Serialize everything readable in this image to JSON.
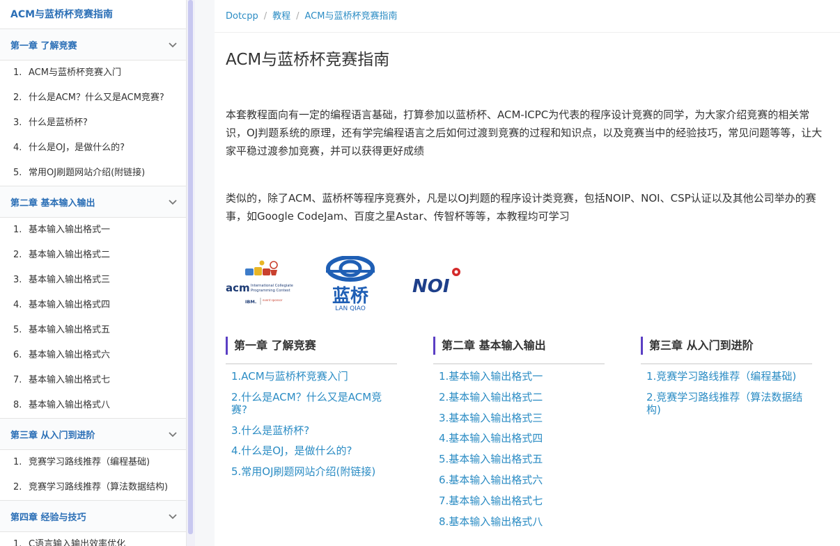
{
  "sidebar": {
    "title": "ACM与蓝桥杯竞赛指南",
    "chapters": [
      {
        "label": "第一章 了解竞赛",
        "items": [
          {
            "num": "1.",
            "label": "ACM与蓝桥杯竞赛入门"
          },
          {
            "num": "2.",
            "label": "什么是ACM？什么又是ACM竞赛?"
          },
          {
            "num": "3.",
            "label": "什么是蓝桥杯?"
          },
          {
            "num": "4.",
            "label": "什么是OJ，是做什么的?"
          },
          {
            "num": "5.",
            "label": "常用OJ刷题网站介绍(附链接)"
          }
        ]
      },
      {
        "label": "第二章 基本输入输出",
        "items": [
          {
            "num": "1.",
            "label": "基本输入输出格式一"
          },
          {
            "num": "2.",
            "label": "基本输入输出格式二"
          },
          {
            "num": "3.",
            "label": "基本输入输出格式三"
          },
          {
            "num": "4.",
            "label": "基本输入输出格式四"
          },
          {
            "num": "5.",
            "label": "基本输入输出格式五"
          },
          {
            "num": "6.",
            "label": "基本输入输出格式六"
          },
          {
            "num": "7.",
            "label": "基本输入输出格式七"
          },
          {
            "num": "8.",
            "label": "基本输入输出格式八"
          }
        ]
      },
      {
        "label": "第三章 从入门到进阶",
        "items": [
          {
            "num": "1.",
            "label": "竞赛学习路线推荐（编程基础)"
          },
          {
            "num": "2.",
            "label": "竞赛学习路线推荐（算法数据结构)"
          }
        ]
      },
      {
        "label": "第四章 经验与技巧",
        "items": [
          {
            "num": "1.",
            "label": "C语言输入输出效率优化"
          }
        ]
      }
    ]
  },
  "breadcrumb": [
    "Dotcpp",
    "教程",
    "ACM与蓝桥杯竞赛指南"
  ],
  "page_title": "ACM与蓝桥杯竞赛指南",
  "paragraphs": [
    "本套教程面向有一定的编程语言基础，打算参加以蓝桥杯、ACM-ICPC为代表的程序设计竞赛的同学，为大家介绍竞赛的相关常识，OJ判题系统的原理，还有学完编程语言之后如何过渡到竞赛的过程和知识点，以及竞赛当中的经验技巧，常见问题等等，让大家平稳过渡参加竞赛，并可以获得更好成绩",
    "类似的，除了ACM、蓝桥杯等程序竞赛外，凡是以OJ判题的程序设计类竞赛，包括NOIP、NOI、CSP认证以及其他公司举办的赛事，如Google CodeJam、百度之星Astar、传智杯等等，本教程均可学习"
  ],
  "logos": {
    "acm": {
      "text_main": "acm",
      "text_sub1": "International Collegiate",
      "text_sub2": "Programming Contest",
      "sponsor": "IBM.",
      "sponsor_note": "event sponsor"
    },
    "lanqiao": {
      "cn": "蓝桥",
      "en": "LAN QIAO"
    },
    "noi": {
      "text": "NOI"
    }
  },
  "columns": [
    {
      "heading": "第一章 了解竞赛",
      "links": [
        "1.ACM与蓝桥杯竞赛入门",
        "2.什么是ACM？什么又是ACM竞赛?",
        "3.什么是蓝桥杯?",
        "4.什么是OJ，是做什么的?",
        "5.常用OJ刷题网站介绍(附链接)"
      ]
    },
    {
      "heading": "第二章 基本输入输出",
      "links": [
        "1.基本输入输出格式一",
        "2.基本输入输出格式二",
        "3.基本输入输出格式三",
        "4.基本输入输出格式四",
        "5.基本输入输出格式五",
        "6.基本输入输出格式六",
        "7.基本输入输出格式七",
        "8.基本输入输出格式八"
      ]
    },
    {
      "heading": "第三章 从入门到进阶",
      "links": [
        "1.竞赛学习路线推荐（编程基础)",
        "2.竞赛学习路线推荐（算法数据结构)"
      ]
    }
  ],
  "colors": {
    "link": "#2b8cc4",
    "sidebar_accent": "#2b6fb6",
    "heading_bar": "#5b3fc4"
  }
}
